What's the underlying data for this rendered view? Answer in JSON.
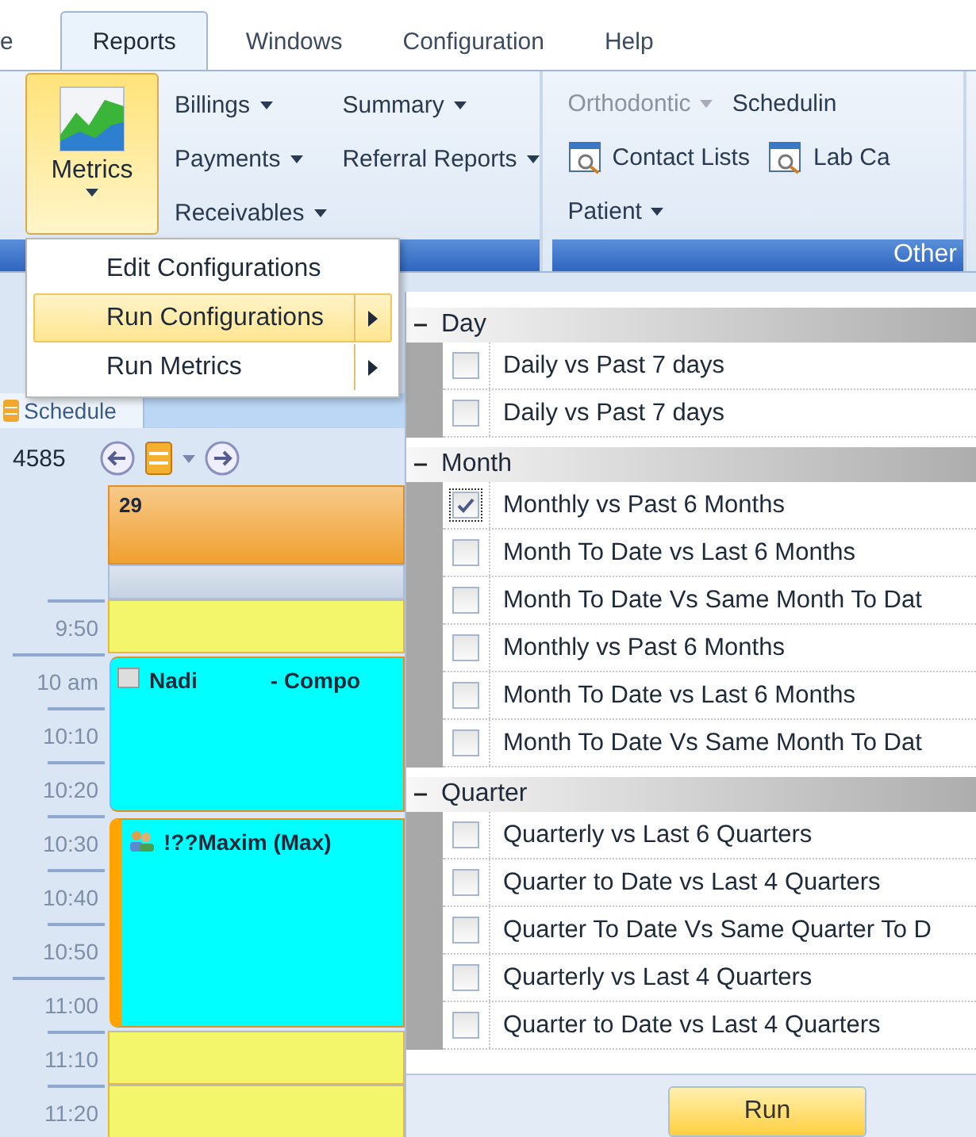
{
  "menu_tabs": [
    {
      "label": "e",
      "selected": false
    },
    {
      "label": "Reports",
      "selected": true
    },
    {
      "label": "Windows",
      "selected": false
    },
    {
      "label": "Configuration",
      "selected": false
    },
    {
      "label": "Help",
      "selected": false
    }
  ],
  "ribbon": {
    "metrics_button": {
      "label": "Metrics",
      "active": true
    },
    "report_columns": [
      [
        {
          "label": "Billings",
          "kind": "dropdown",
          "disabled": false
        },
        {
          "label": "Payments",
          "kind": "dropdown",
          "disabled": false
        },
        {
          "label": "Receivables",
          "kind": "dropdown",
          "disabled": false
        }
      ],
      [
        {
          "label": "Summary",
          "kind": "dropdown",
          "disabled": false
        },
        {
          "label": "Referral Reports",
          "kind": "dropdown",
          "disabled": false
        }
      ]
    ],
    "other_group": {
      "label": "Other",
      "rows": [
        [
          {
            "label": "Orthodontic",
            "kind": "dropdown",
            "disabled": true
          },
          {
            "label": "Schedulin",
            "kind": "plain",
            "disabled": false
          }
        ],
        [
          {
            "label": "Contact Lists",
            "kind": "icon",
            "disabled": false
          },
          {
            "label": "Lab Ca",
            "kind": "icon",
            "disabled": false
          }
        ],
        [
          {
            "label": "Patient",
            "kind": "dropdown",
            "disabled": false
          }
        ]
      ]
    }
  },
  "metrics_menu": [
    {
      "label": "Edit Configurations",
      "selected": false,
      "submenu": false
    },
    {
      "label": "Run Configurations",
      "selected": true,
      "submenu": true
    },
    {
      "label": "Run Metrics",
      "selected": false,
      "submenu": true
    }
  ],
  "schedule": {
    "tab": "Schedule",
    "record": "4585",
    "day": "29",
    "slots": [
      {
        "time": "9:50",
        "kind": "open"
      },
      {
        "time": "10 am",
        "kind": "appointment",
        "appointment": {
          "name": "Nadi",
          "detail": "- Compo",
          "kind": "single",
          "flagged": false
        }
      },
      {
        "time": "10:10",
        "kind": "continued"
      },
      {
        "time": "10:20",
        "kind": "continued"
      },
      {
        "time": "10:30",
        "kind": "appointment",
        "appointment": {
          "name": "!??Maxim (Max)",
          "kind": "group",
          "flagged": true
        }
      },
      {
        "time": "10:40",
        "kind": "continued"
      },
      {
        "time": "10:50",
        "kind": "continued"
      },
      {
        "time": "11:00",
        "kind": "continued"
      },
      {
        "time": "11:10",
        "kind": "open"
      },
      {
        "time": "11:20",
        "kind": "open"
      }
    ]
  },
  "configurations": {
    "groups": [
      {
        "label": "Day",
        "expanded": true,
        "items": [
          {
            "label": "Daily vs Past 7 days",
            "checked": false
          },
          {
            "label": "Daily vs Past 7 days",
            "checked": false
          }
        ]
      },
      {
        "label": "Month",
        "expanded": true,
        "items": [
          {
            "label": "Monthly vs Past 6 Months",
            "checked": true
          },
          {
            "label": "Month To Date vs Last 6 Months",
            "checked": false
          },
          {
            "label": "Month To Date Vs Same Month To Dat",
            "checked": false
          },
          {
            "label": "Monthly vs Past 6 Months",
            "checked": false
          },
          {
            "label": "Month To Date vs Last 6 Months",
            "checked": false
          },
          {
            "label": "Month To Date Vs Same Month To Dat",
            "checked": false
          }
        ]
      },
      {
        "label": "Quarter",
        "expanded": true,
        "items": [
          {
            "label": "Quarterly vs Last 6 Quarters",
            "checked": false
          },
          {
            "label": "Quarter to Date vs Last 4 Quarters",
            "checked": false
          },
          {
            "label": "Quarter To Date Vs Same Quarter To D",
            "checked": false
          },
          {
            "label": "Quarterly vs Last 4 Quarters",
            "checked": false
          },
          {
            "label": "Quarter to Date vs Last 4 Quarters",
            "checked": false
          }
        ]
      }
    ],
    "run_button": "Run"
  }
}
